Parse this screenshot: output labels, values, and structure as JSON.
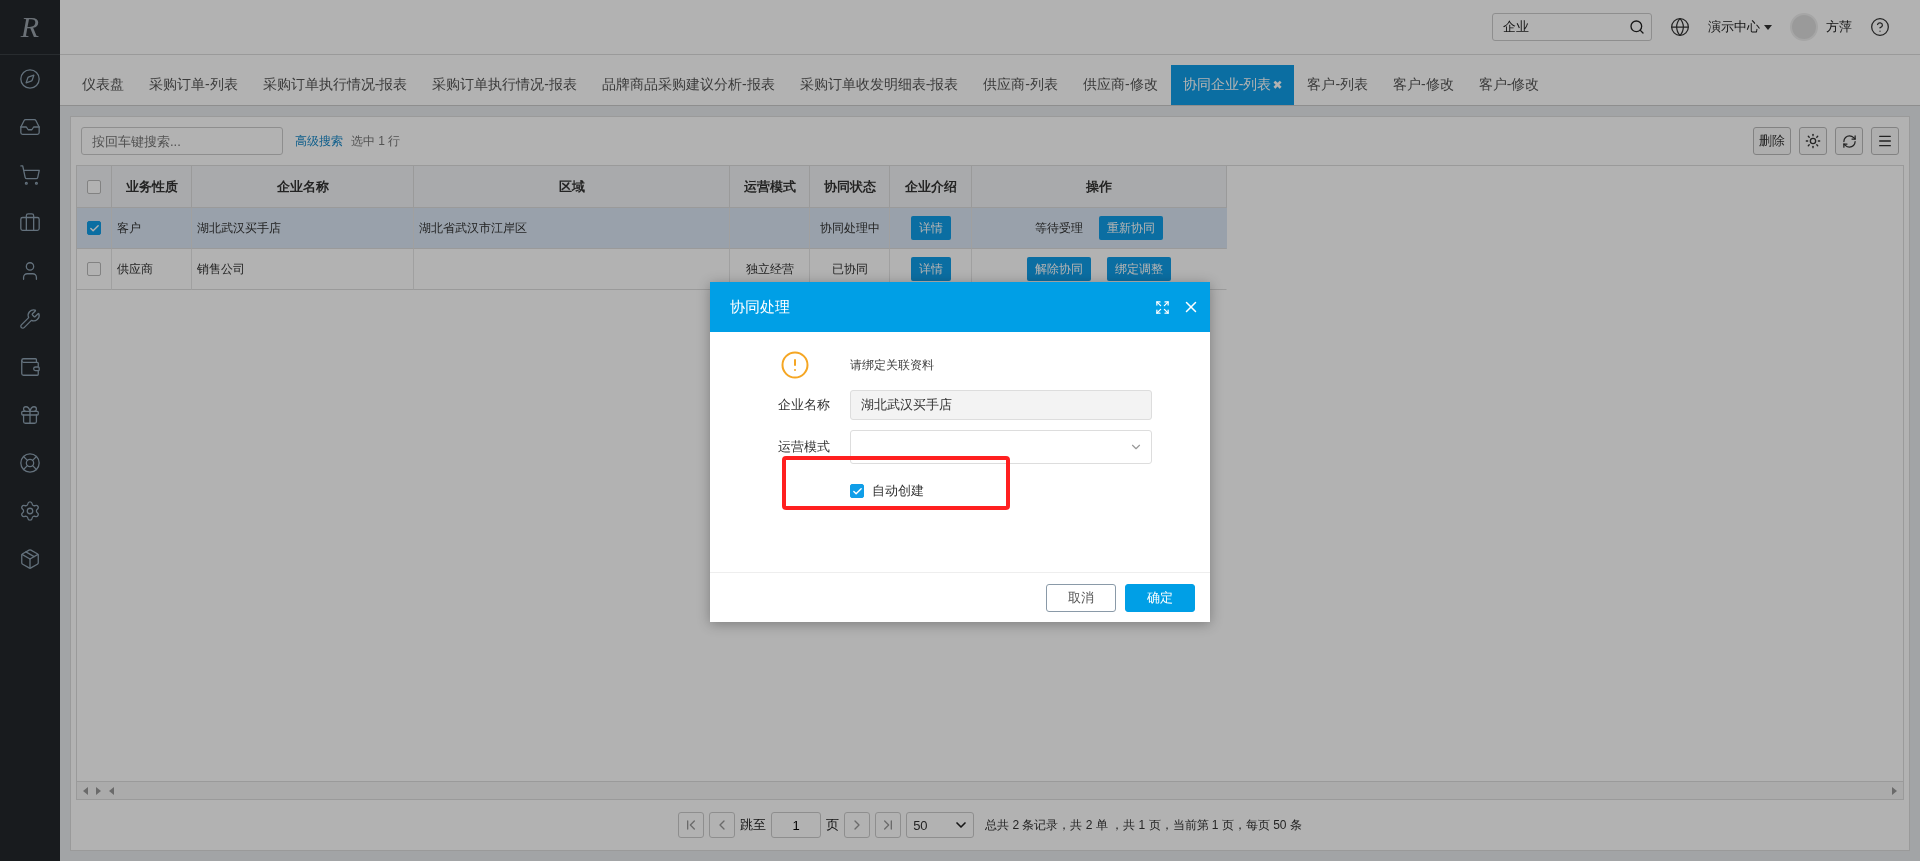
{
  "sidebar": {
    "logo": "R"
  },
  "header": {
    "search": {
      "value": "企业"
    },
    "org": "演示中心",
    "user": "方萍"
  },
  "tabs": [
    {
      "label": "仪表盘",
      "selected": false
    },
    {
      "label": "采购订单-列表",
      "selected": false
    },
    {
      "label": "采购订单执行情况-报表",
      "selected": false
    },
    {
      "label": "采购订单执行情况-报表",
      "selected": false
    },
    {
      "label": "品牌商品采购建议分析-报表",
      "selected": false
    },
    {
      "label": "采购订单收发明细表-报表",
      "selected": false
    },
    {
      "label": "供应商-列表",
      "selected": false
    },
    {
      "label": "供应商-修改",
      "selected": false
    },
    {
      "label": "协同企业-列表",
      "selected": true,
      "close": "✖"
    },
    {
      "label": "客户-列表",
      "selected": false
    },
    {
      "label": "客户-修改",
      "selected": false
    },
    {
      "label": "客户-修改",
      "selected": false
    }
  ],
  "toolbar": {
    "search_placeholder": "按回车键搜索...",
    "advanced": "高级搜索",
    "selection": "选中 1 行",
    "delete": "删除"
  },
  "table": {
    "all_selected": false,
    "columns": [
      "业务性质",
      "企业名称",
      "区域",
      "运营模式",
      "协同状态",
      "企业介绍",
      "操作"
    ],
    "rows": [
      {
        "selected": true,
        "nature": "客户",
        "name": "湖北武汉买手店",
        "region": "湖北省武汉市江岸区",
        "status": "协同处理中",
        "intro": "详情",
        "actions": [
          {
            "kind": "text",
            "label": "等待受理"
          },
          {
            "kind": "button",
            "label": "重新协同"
          }
        ]
      },
      {
        "selected": false,
        "nature": "供应商",
        "name": "销售公司",
        "mode": "独立经营",
        "status": "已协同",
        "intro": "详情",
        "actions": [
          {
            "kind": "button",
            "label": "解除协同"
          },
          {
            "kind": "button",
            "label": "绑定调整"
          }
        ]
      }
    ]
  },
  "pagination": {
    "jump": "跳至",
    "page": "1",
    "unit": "页",
    "size": "50",
    "summary": "总共 2 条记录，共 2 单 ，共 1 页，当前第 1 页，每页 50 条"
  },
  "dialog": {
    "title": "协同处理",
    "notice": "请绑定关联资料",
    "fields": [
      {
        "kind": "text",
        "label": "企业名称",
        "value": "湖北武汉买手店"
      },
      {
        "kind": "select",
        "label": "运营模式"
      }
    ],
    "auto_create": {
      "label": "自动创建",
      "checked": true
    },
    "highlighted": true,
    "buttons": [
      {
        "kind": "secondary",
        "label": "取消"
      },
      {
        "kind": "primary",
        "label": "确定"
      }
    ]
  }
}
